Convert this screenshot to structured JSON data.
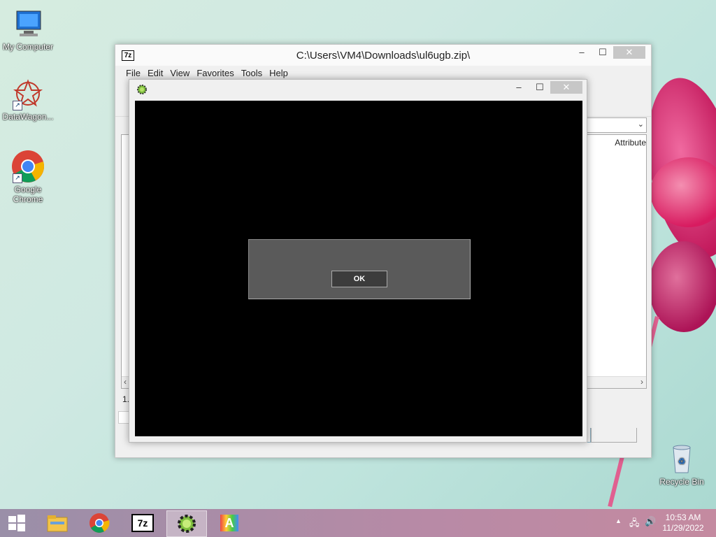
{
  "desktop": {
    "icons": [
      {
        "label": "My Computer"
      },
      {
        "label": "DataWagon..."
      },
      {
        "label": "Google Chrome"
      },
      {
        "label": "Recycle Bin"
      }
    ]
  },
  "window_7zip": {
    "title": "C:\\Users\\VM4\\Downloads\\ul6ugb.zip\\",
    "icon_text": "7z",
    "menu": [
      "File",
      "Edit",
      "View",
      "Favorites",
      "Tools",
      "Help"
    ],
    "column_header_partial": "Attribute",
    "status_partial": "1."
  },
  "app_window": {
    "dialog": {
      "ok_label": "OK"
    }
  },
  "taskbar": {
    "items": [
      "start",
      "file-explorer",
      "google-chrome",
      "7-zip",
      "gear-app",
      "font-app"
    ],
    "active_item": "gear-app",
    "clock": {
      "time": "10:53 AM",
      "date": "11/29/2022"
    }
  }
}
